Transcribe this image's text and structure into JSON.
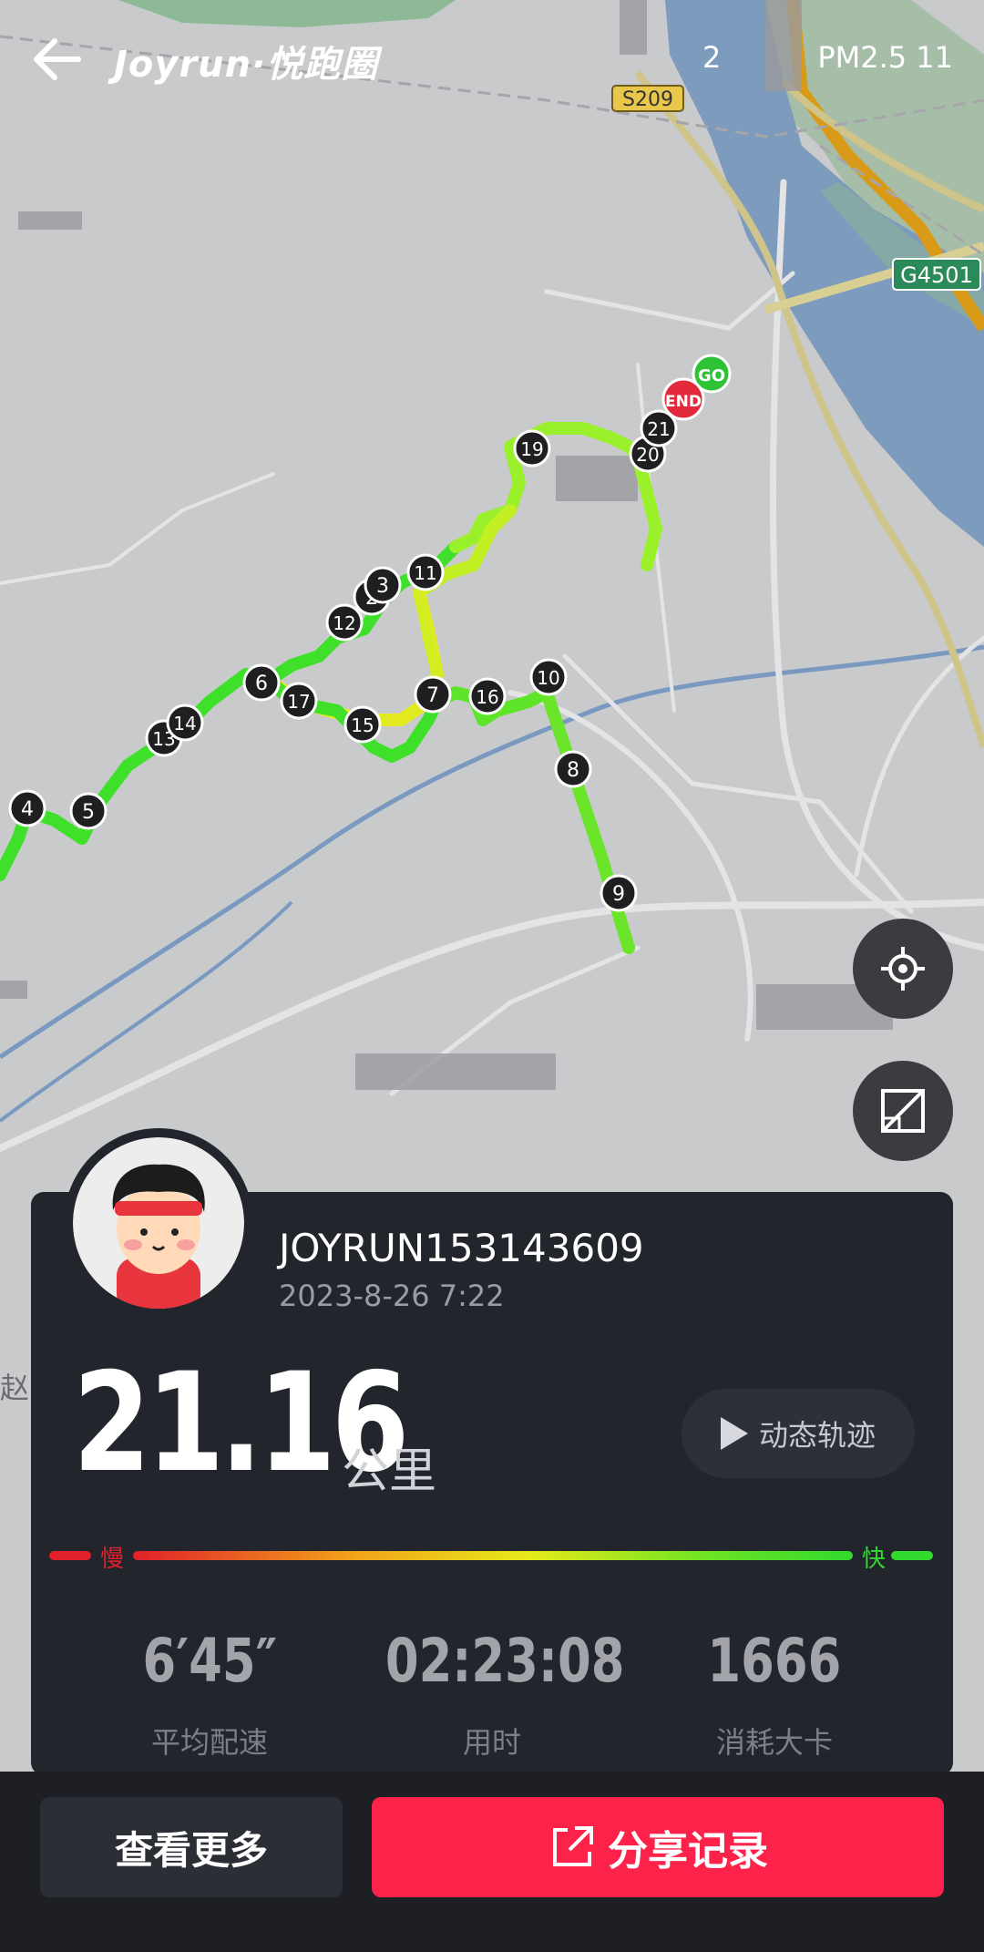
{
  "header": {
    "back_label": "",
    "brand": "Joyrun·悦跑圈",
    "weather_left": "2",
    "weather_right": "PM2.5 11"
  },
  "map": {
    "road_labels": [
      "S209",
      "G4501"
    ],
    "place_fragment": "赵家",
    "markers": [
      "GO",
      "END"
    ],
    "km_markers": [
      "2",
      "3",
      "4",
      "5",
      "6",
      "7",
      "8",
      "9",
      "10",
      "11",
      "12",
      "13",
      "14",
      "15",
      "16",
      "17",
      "19",
      "20",
      "21"
    ]
  },
  "profile": {
    "username": "JOYRUN153143609",
    "datetime": "2023-8-26 7:22"
  },
  "summary": {
    "distance": "21.16",
    "unit": "公里",
    "replay_label": "动态轨迹"
  },
  "speed_legend": {
    "slow": "慢",
    "fast": "快"
  },
  "stats": [
    {
      "value": "6′45″",
      "label": "平均配速"
    },
    {
      "value": "02:23:08",
      "label": "用时"
    },
    {
      "value": "1666",
      "label": "消耗大卡"
    }
  ],
  "actions": {
    "more": "查看更多",
    "share": "分享记录"
  },
  "colors": {
    "accent": "#fc2249",
    "card": "#23252d",
    "route_fast": "#32d92e",
    "route_slow": "#e6ea1a"
  }
}
